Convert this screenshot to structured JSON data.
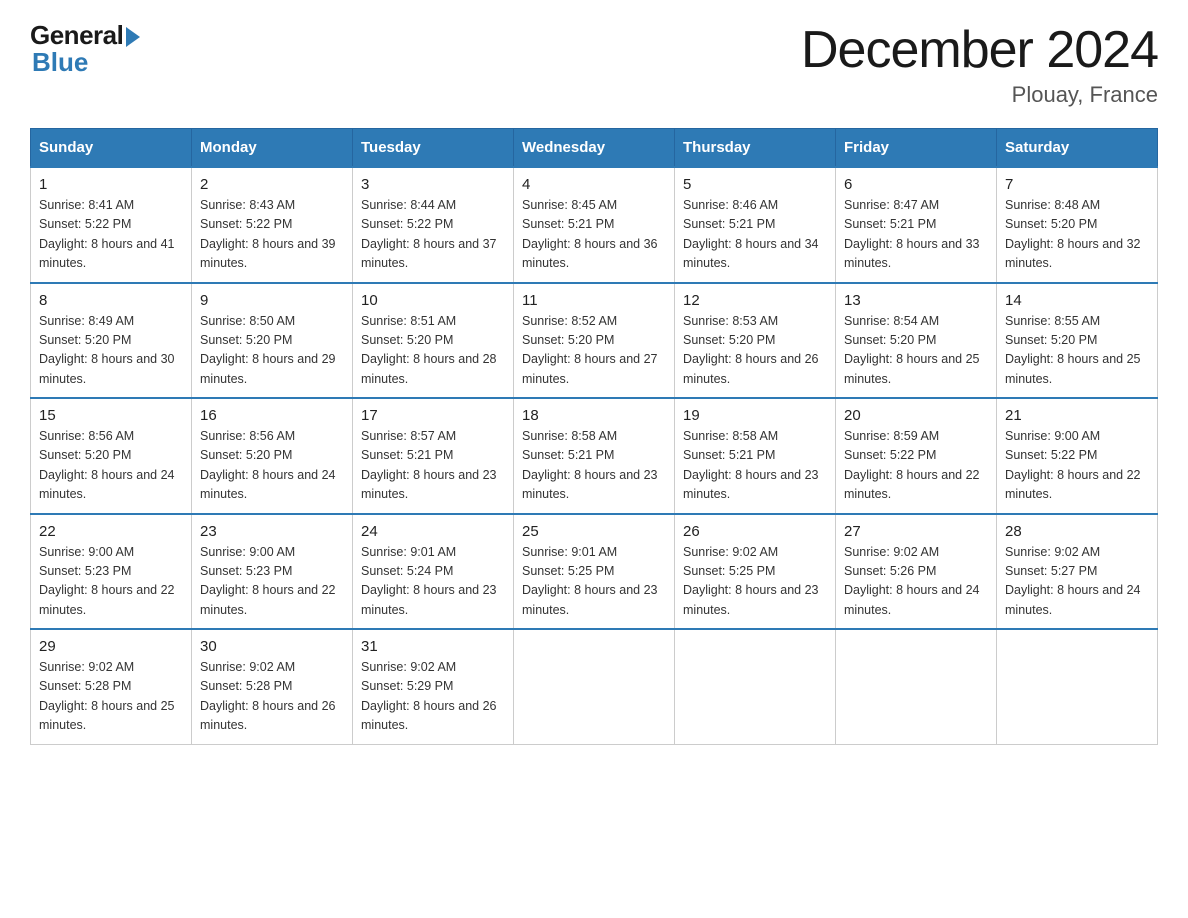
{
  "logo": {
    "general": "General",
    "blue": "Blue"
  },
  "title": "December 2024",
  "location": "Plouay, France",
  "days_of_week": [
    "Sunday",
    "Monday",
    "Tuesday",
    "Wednesday",
    "Thursday",
    "Friday",
    "Saturday"
  ],
  "weeks": [
    [
      {
        "day": "1",
        "sunrise": "8:41 AM",
        "sunset": "5:22 PM",
        "daylight": "8 hours and 41 minutes."
      },
      {
        "day": "2",
        "sunrise": "8:43 AM",
        "sunset": "5:22 PM",
        "daylight": "8 hours and 39 minutes."
      },
      {
        "day": "3",
        "sunrise": "8:44 AM",
        "sunset": "5:22 PM",
        "daylight": "8 hours and 37 minutes."
      },
      {
        "day": "4",
        "sunrise": "8:45 AM",
        "sunset": "5:21 PM",
        "daylight": "8 hours and 36 minutes."
      },
      {
        "day": "5",
        "sunrise": "8:46 AM",
        "sunset": "5:21 PM",
        "daylight": "8 hours and 34 minutes."
      },
      {
        "day": "6",
        "sunrise": "8:47 AM",
        "sunset": "5:21 PM",
        "daylight": "8 hours and 33 minutes."
      },
      {
        "day": "7",
        "sunrise": "8:48 AM",
        "sunset": "5:20 PM",
        "daylight": "8 hours and 32 minutes."
      }
    ],
    [
      {
        "day": "8",
        "sunrise": "8:49 AM",
        "sunset": "5:20 PM",
        "daylight": "8 hours and 30 minutes."
      },
      {
        "day": "9",
        "sunrise": "8:50 AM",
        "sunset": "5:20 PM",
        "daylight": "8 hours and 29 minutes."
      },
      {
        "day": "10",
        "sunrise": "8:51 AM",
        "sunset": "5:20 PM",
        "daylight": "8 hours and 28 minutes."
      },
      {
        "day": "11",
        "sunrise": "8:52 AM",
        "sunset": "5:20 PM",
        "daylight": "8 hours and 27 minutes."
      },
      {
        "day": "12",
        "sunrise": "8:53 AM",
        "sunset": "5:20 PM",
        "daylight": "8 hours and 26 minutes."
      },
      {
        "day": "13",
        "sunrise": "8:54 AM",
        "sunset": "5:20 PM",
        "daylight": "8 hours and 25 minutes."
      },
      {
        "day": "14",
        "sunrise": "8:55 AM",
        "sunset": "5:20 PM",
        "daylight": "8 hours and 25 minutes."
      }
    ],
    [
      {
        "day": "15",
        "sunrise": "8:56 AM",
        "sunset": "5:20 PM",
        "daylight": "8 hours and 24 minutes."
      },
      {
        "day": "16",
        "sunrise": "8:56 AM",
        "sunset": "5:20 PM",
        "daylight": "8 hours and 24 minutes."
      },
      {
        "day": "17",
        "sunrise": "8:57 AM",
        "sunset": "5:21 PM",
        "daylight": "8 hours and 23 minutes."
      },
      {
        "day": "18",
        "sunrise": "8:58 AM",
        "sunset": "5:21 PM",
        "daylight": "8 hours and 23 minutes."
      },
      {
        "day": "19",
        "sunrise": "8:58 AM",
        "sunset": "5:21 PM",
        "daylight": "8 hours and 23 minutes."
      },
      {
        "day": "20",
        "sunrise": "8:59 AM",
        "sunset": "5:22 PM",
        "daylight": "8 hours and 22 minutes."
      },
      {
        "day": "21",
        "sunrise": "9:00 AM",
        "sunset": "5:22 PM",
        "daylight": "8 hours and 22 minutes."
      }
    ],
    [
      {
        "day": "22",
        "sunrise": "9:00 AM",
        "sunset": "5:23 PM",
        "daylight": "8 hours and 22 minutes."
      },
      {
        "day": "23",
        "sunrise": "9:00 AM",
        "sunset": "5:23 PM",
        "daylight": "8 hours and 22 minutes."
      },
      {
        "day": "24",
        "sunrise": "9:01 AM",
        "sunset": "5:24 PM",
        "daylight": "8 hours and 23 minutes."
      },
      {
        "day": "25",
        "sunrise": "9:01 AM",
        "sunset": "5:25 PM",
        "daylight": "8 hours and 23 minutes."
      },
      {
        "day": "26",
        "sunrise": "9:02 AM",
        "sunset": "5:25 PM",
        "daylight": "8 hours and 23 minutes."
      },
      {
        "day": "27",
        "sunrise": "9:02 AM",
        "sunset": "5:26 PM",
        "daylight": "8 hours and 24 minutes."
      },
      {
        "day": "28",
        "sunrise": "9:02 AM",
        "sunset": "5:27 PM",
        "daylight": "8 hours and 24 minutes."
      }
    ],
    [
      {
        "day": "29",
        "sunrise": "9:02 AM",
        "sunset": "5:28 PM",
        "daylight": "8 hours and 25 minutes."
      },
      {
        "day": "30",
        "sunrise": "9:02 AM",
        "sunset": "5:28 PM",
        "daylight": "8 hours and 26 minutes."
      },
      {
        "day": "31",
        "sunrise": "9:02 AM",
        "sunset": "5:29 PM",
        "daylight": "8 hours and 26 minutes."
      },
      null,
      null,
      null,
      null
    ]
  ],
  "labels": {
    "sunrise": "Sunrise:",
    "sunset": "Sunset:",
    "daylight": "Daylight:"
  },
  "colors": {
    "header_bg": "#2e7ab5",
    "border": "#ccc",
    "accent_border": "#2e7ab5"
  }
}
